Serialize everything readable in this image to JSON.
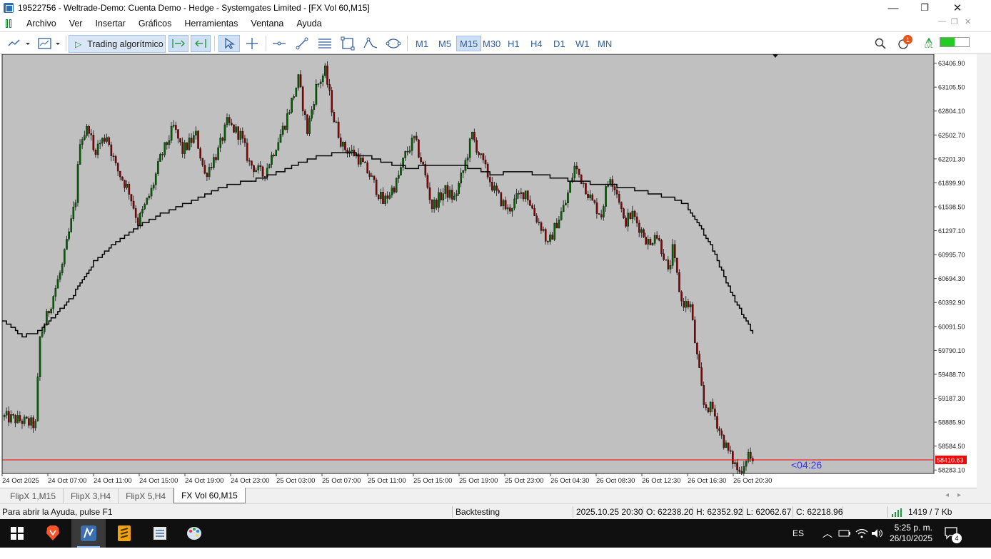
{
  "window": {
    "title": "19522756 - Weltrade-Demo: Cuenta Demo - Hedge - Systemgates Limited - [FX Vol 60,M15]",
    "minimize": "—",
    "maximize": "❐",
    "close": "✕"
  },
  "menu": {
    "items": [
      "Archivo",
      "Ver",
      "Insertar",
      "Gráficos",
      "Herramientas",
      "Ventana",
      "Ayuda"
    ]
  },
  "toolbar": {
    "algo_trading_label": "Trading algorítmico",
    "timeframes": [
      "M1",
      "M5",
      "M15",
      "M30",
      "H1",
      "H4",
      "D1",
      "W1",
      "MN"
    ],
    "selected_timeframe": "M15",
    "notification_count": "1",
    "connection_icon_label": "LVL"
  },
  "chart": {
    "background": "#c0c0c0",
    "bull_color": "#006400",
    "bear_color": "#8b0000",
    "ma_color": "#000000",
    "bid_line_color": "#ff0000",
    "current_price_label": "58410.63",
    "countdown": "<04:26",
    "countdown_color": "#3333ff"
  },
  "chart_data": {
    "type": "candlestick",
    "symbol": "FX Vol 60",
    "timeframe": "M15",
    "y_ticks": [
      "63406.90",
      "63105.50",
      "62804.10",
      "62502.70",
      "62201.30",
      "61899.90",
      "61598.50",
      "61297.10",
      "60995.70",
      "60694.30",
      "60392.90",
      "60091.50",
      "59790.10",
      "59488.70",
      "59187.30",
      "58885.90",
      "58584.50",
      "58283.10"
    ],
    "x_ticks": [
      "24 Oct 2025",
      "24 Oct 07:00",
      "24 Oct 11:00",
      "24 Oct 15:00",
      "24 Oct 19:00",
      "24 Oct 23:00",
      "25 Oct 03:00",
      "25 Oct 07:00",
      "25 Oct 11:00",
      "25 Oct 15:00",
      "25 Oct 19:00",
      "25 Oct 23:00",
      "26 Oct 04:30",
      "26 Oct 08:30",
      "26 Oct 12:30",
      "26 Oct 16:30",
      "26 Oct 20:30"
    ],
    "ylim": [
      58240,
      63520
    ],
    "close_path": [
      [
        0,
        58950
      ],
      [
        8,
        58900
      ],
      [
        14,
        58850
      ],
      [
        16,
        59950
      ],
      [
        20,
        60300
      ],
      [
        26,
        60850
      ],
      [
        30,
        61400
      ],
      [
        32,
        61700
      ],
      [
        34,
        62450
      ],
      [
        38,
        62600
      ],
      [
        40,
        62300
      ],
      [
        46,
        62500
      ],
      [
        50,
        62100
      ],
      [
        56,
        61800
      ],
      [
        60,
        61400
      ],
      [
        66,
        61800
      ],
      [
        70,
        62200
      ],
      [
        76,
        62600
      ],
      [
        80,
        62300
      ],
      [
        86,
        62500
      ],
      [
        90,
        62000
      ],
      [
        96,
        62300
      ],
      [
        100,
        62650
      ],
      [
        106,
        62500
      ],
      [
        110,
        62150
      ],
      [
        116,
        62000
      ],
      [
        118,
        62100
      ],
      [
        126,
        62650
      ],
      [
        132,
        63200
      ],
      [
        136,
        62550
      ],
      [
        140,
        63100
      ],
      [
        144,
        63300
      ],
      [
        148,
        62700
      ],
      [
        152,
        62350
      ],
      [
        158,
        62250
      ],
      [
        164,
        62000
      ],
      [
        170,
        61650
      ],
      [
        176,
        61900
      ],
      [
        180,
        62250
      ],
      [
        184,
        62450
      ],
      [
        188,
        62100
      ],
      [
        192,
        61600
      ],
      [
        198,
        61800
      ],
      [
        202,
        61700
      ],
      [
        206,
        62050
      ],
      [
        210,
        62500
      ],
      [
        214,
        62200
      ],
      [
        220,
        61800
      ],
      [
        226,
        61550
      ],
      [
        230,
        61700
      ],
      [
        234,
        61800
      ],
      [
        238,
        61500
      ],
      [
        242,
        61300
      ],
      [
        244,
        61100
      ],
      [
        248,
        61400
      ],
      [
        252,
        61650
      ],
      [
        256,
        62100
      ],
      [
        260,
        61900
      ],
      [
        264,
        61650
      ],
      [
        268,
        61500
      ],
      [
        270,
        61800
      ],
      [
        272,
        62000
      ],
      [
        276,
        61700
      ],
      [
        278,
        61400
      ],
      [
        282,
        61500
      ],
      [
        286,
        61300
      ],
      [
        290,
        61100
      ],
      [
        292,
        61300
      ],
      [
        294,
        61150
      ],
      [
        296,
        61000
      ],
      [
        298,
        60750
      ],
      [
        300,
        61050
      ],
      [
        304,
        60400
      ],
      [
        308,
        60350
      ],
      [
        310,
        59900
      ],
      [
        312,
        59500
      ],
      [
        314,
        59100
      ],
      [
        318,
        59050
      ],
      [
        322,
        58700
      ],
      [
        326,
        58450
      ],
      [
        330,
        58250
      ],
      [
        334,
        58500
      ],
      [
        336,
        58350
      ]
    ],
    "ma_path": [
      [
        0,
        60150
      ],
      [
        8,
        59970
      ],
      [
        14,
        60000
      ],
      [
        20,
        60160
      ],
      [
        30,
        60450
      ],
      [
        40,
        60900
      ],
      [
        50,
        61150
      ],
      [
        60,
        61350
      ],
      [
        70,
        61500
      ],
      [
        80,
        61620
      ],
      [
        90,
        61750
      ],
      [
        100,
        61870
      ],
      [
        110,
        61920
      ],
      [
        120,
        62000
      ],
      [
        132,
        62140
      ],
      [
        142,
        62240
      ],
      [
        152,
        62280
      ],
      [
        162,
        62240
      ],
      [
        172,
        62150
      ],
      [
        182,
        62080
      ],
      [
        192,
        62130
      ],
      [
        202,
        62130
      ],
      [
        212,
        62070
      ],
      [
        220,
        62000
      ],
      [
        230,
        62050
      ],
      [
        240,
        62000
      ],
      [
        250,
        61950
      ],
      [
        262,
        61900
      ],
      [
        272,
        61870
      ],
      [
        282,
        61820
      ],
      [
        292,
        61760
      ],
      [
        300,
        61700
      ],
      [
        306,
        61620
      ],
      [
        312,
        61360
      ],
      [
        318,
        61050
      ],
      [
        324,
        60650
      ],
      [
        330,
        60300
      ],
      [
        336,
        60000
      ]
    ],
    "current_price": 58410.63
  },
  "tabs": [
    {
      "label": "FlipX 1,M15",
      "active": false
    },
    {
      "label": "FlipX 3,H4",
      "active": false
    },
    {
      "label": "FlipX 5,H4",
      "active": false
    },
    {
      "label": "FX Vol 60,M15",
      "active": true
    }
  ],
  "status": {
    "help": "Para abrir la Ayuda, pulse F1",
    "mode": "Backtesting",
    "datetime": "2025.10.25 20:30",
    "open": "O: 62238.20",
    "high": "H: 62352.92",
    "low": "L: 62062.67",
    "close": "C: 62218.96",
    "traffic": "1419 / 7 Kb"
  },
  "taskbar": {
    "language": "ES",
    "time": "5:25 p. m.",
    "date": "26/10/2025",
    "notifications": "4"
  }
}
